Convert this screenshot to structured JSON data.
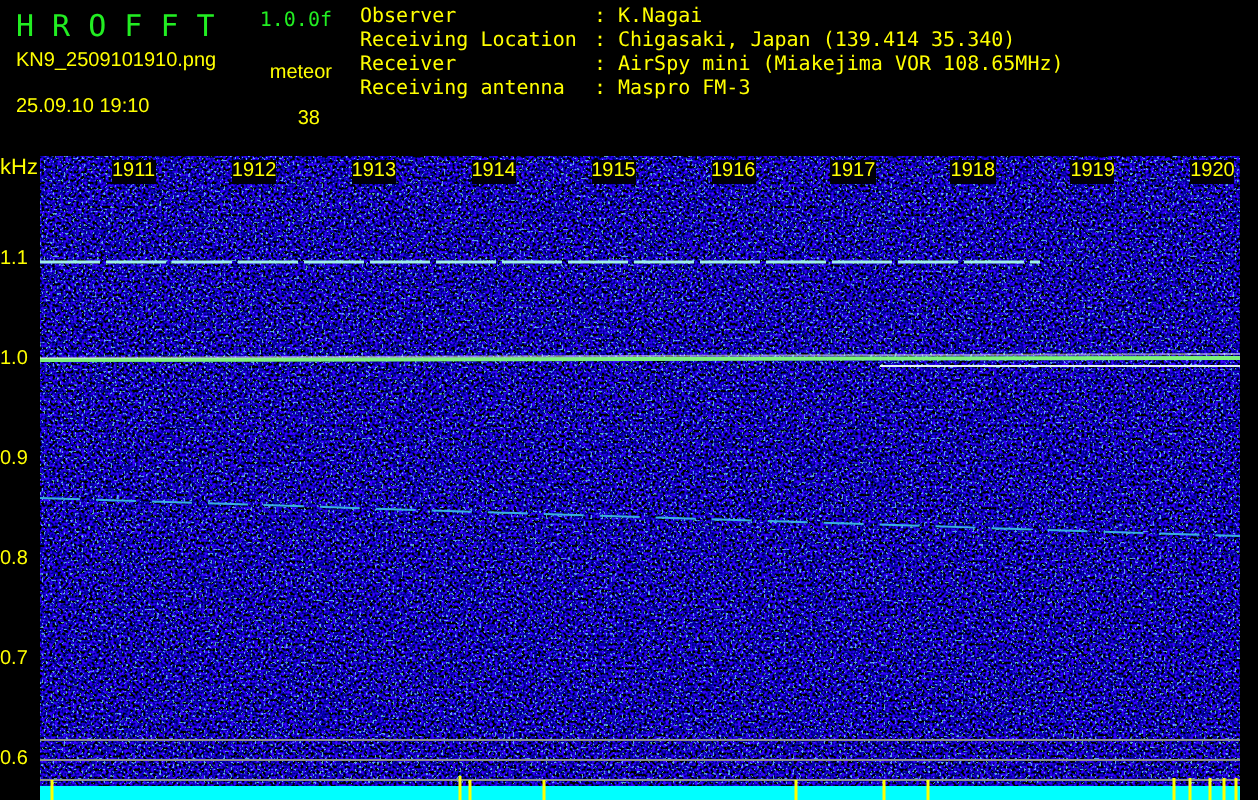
{
  "header": {
    "title": "H R O F F T",
    "version": "1.0.0f",
    "filename": "KN9_2509101910.png",
    "timestamp": "25.09.10 19:10",
    "count_label": "meteor",
    "count": "38"
  },
  "info": [
    {
      "label": "Observer",
      "separator": ":",
      "value": "K.Nagai"
    },
    {
      "label": "Receiving Location",
      "separator": ":",
      "value": "Chigasaki, Japan (139.414 35.340)"
    },
    {
      "label": "Receiver",
      "separator": ":",
      "value": "AirSpy mini (Miakejima VOR 108.65MHz)"
    },
    {
      "label": "Receiving antenna",
      "separator": ":",
      "value": "Maspro FM-3"
    }
  ],
  "time_labels": [
    "1911",
    "1912",
    "1913",
    "1914",
    "1915",
    "1916",
    "1917",
    "1918",
    "1919",
    "1920"
  ],
  "y_axis": {
    "unit": "kHz",
    "ticks": [
      "1.1",
      "1.0",
      "0.9",
      "0.8",
      "0.7",
      "0.6"
    ]
  }
}
